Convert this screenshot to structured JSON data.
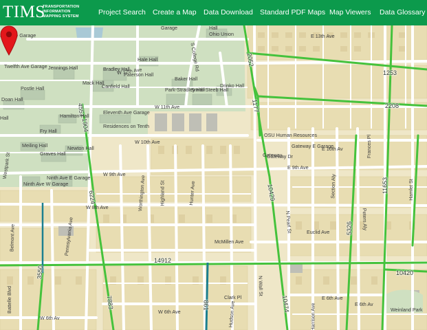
{
  "header": {
    "logo_text": "TIMS",
    "logo_subtitle": [
      "TRANSPORTATION",
      "INFORMATION",
      "MAPPING SYSTEM"
    ],
    "nav": [
      "Project Search",
      "Create a Map",
      "Data Download",
      "Standard PDF Maps",
      "Map Viewers",
      "Data Glossary"
    ]
  },
  "map": {
    "route_labels": [
      "1253",
      "2208",
      "2052",
      "1177",
      "10420",
      "14912",
      "10429",
      "10474",
      "861",
      "7883",
      "3550",
      "6224",
      "4551",
      "1904",
      "5326",
      "11653"
    ],
    "street_labels": [
      "W 12th Ave",
      "W 11th Ave",
      "W 10th Ave",
      "W 9th Ave",
      "W 8th Ave",
      "W 6th Ave",
      "W 6th Av",
      "E 13th Ave",
      "E 10th Av",
      "E 9th Ave",
      "E 6th Ave",
      "E 6th Av",
      "McMillen Ave",
      "Euclid Ave",
      "Clark Pl",
      "Worthington Ave",
      "Highland St",
      "Hunter Ave",
      "Pennsylvania Ave",
      "Belmont Ave",
      "Battelle Blvd",
      "Westpark St",
      "N Pearl St",
      "N Wall St",
      "Section Aly",
      "Peters Aly",
      "Frances Pl",
      "Hamlet St",
      "S College Rd",
      "Gateway Dr",
      "Hudson Ave",
      "Harrison Ave"
    ],
    "place_labels": [
      "Neil Ave Garage",
      "Twelfth Ave Garage",
      "Postle Hall",
      "Doan Hall",
      "Jennings Hall",
      "Hale Hall",
      "Bradley Hall",
      "Paterson Hall",
      "Mack Hall",
      "Canfield Hall",
      "Baker Hall",
      "Park-Stradley Hall",
      "Smith-Steeb Hall",
      "Drinko Hall",
      "Hamilton Hall",
      "Fry Hall",
      "Eleventh Ave Garage",
      "Residences on Tenth",
      "Meiling Hall",
      "Newton Hall",
      "Graves Hall",
      "Ninth Ave E Garage",
      "Ninth Ave W Garage",
      "Gateway E Garage",
      "Gateway",
      "OSU Human Resources",
      "Ohio Union",
      "Garage",
      "Weinland Park",
      "Hall",
      "Hall"
    ]
  },
  "colors": {
    "header_bg": "#0c9a4c",
    "route": "#45c23c",
    "route_blue": "#1b7f8f",
    "park": "#cfe0c1",
    "block": "#e8ddb2",
    "road": "#ffffff",
    "pin": "#e3171b"
  }
}
